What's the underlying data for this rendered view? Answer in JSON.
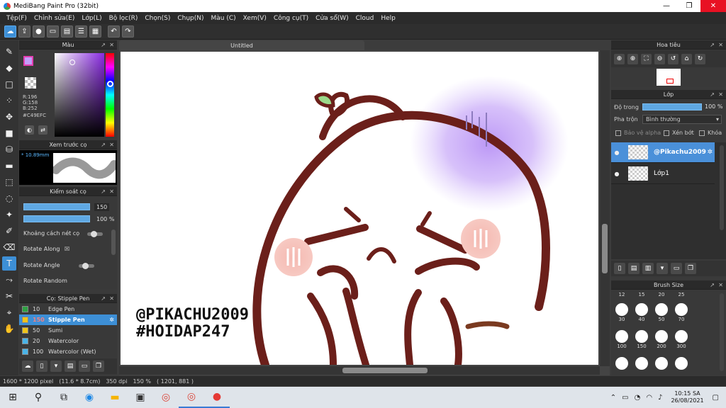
{
  "window": {
    "title": "MediBang Paint Pro (32bit)",
    "min": "—",
    "max": "❐",
    "close": "✕"
  },
  "menu": [
    "Tệp(F)",
    "Chỉnh sửa(E)",
    "Lớp(L)",
    "Bộ lọc(R)",
    "Chọn(S)",
    "Chụp(N)",
    "Màu (C)",
    "Xem(V)",
    "Công cụ(T)",
    "Cửa sổ(W)",
    "Cloud",
    "Help"
  ],
  "toolbar_icons": [
    "cloud-icon",
    "share-icon",
    "chat-icon",
    "comment-icon",
    "page-icon",
    "list-icon",
    "grid-icon",
    "undo-icon",
    "redo-icon"
  ],
  "color_panel": {
    "title": "Màu",
    "r": "R:196",
    "g": "G:158",
    "b": "B:252",
    "hex": "#C49EFC",
    "fg_color": "#C49EFC"
  },
  "brush_preview": {
    "title": "Xem trước cọ",
    "size": "* 10.89mm"
  },
  "brush_control": {
    "title": "Kiểm soát cọ",
    "size_value": "150",
    "opacity_value": "100 %",
    "options": [
      "Khoảng cách nét cọ",
      "Rotate Along",
      "Rotate Angle",
      "Rotate Random"
    ]
  },
  "brush_list": {
    "title": "Cọ: Stipple Pen",
    "items": [
      {
        "num": "10",
        "name": "Edge Pen",
        "color": "#2ea043",
        "selected": false
      },
      {
        "num": "150",
        "name": "Stipple Pen",
        "color": "#f0c419",
        "selected": true
      },
      {
        "num": "50",
        "name": "Sumi",
        "color": "#f0c419",
        "selected": false
      },
      {
        "num": "20",
        "name": "Watercolor",
        "color": "#4ab4e8",
        "selected": false
      },
      {
        "num": "100",
        "name": "Watercolor (Wet)",
        "color": "#4ab4e8",
        "selected": false
      }
    ]
  },
  "document": {
    "tab_title": "Untitled",
    "watermark_line1": "@PIKACHU2009",
    "watermark_line2": "#HOIDAP247"
  },
  "navigator": {
    "title": "Hoa tiêu"
  },
  "layers": {
    "title": "Lớp",
    "opacity_label": "Độ trong",
    "opacity_value": "100 %",
    "blend_label": "Pha trộn",
    "blend_value": "Bình thường",
    "protect_alpha": "Bảo vệ alpha",
    "clipping": "Xén bớt",
    "lock": "Khóa",
    "items": [
      {
        "name": "@Pikachu2009",
        "selected": true
      },
      {
        "name": "Lớp1",
        "selected": false
      }
    ]
  },
  "brush_size": {
    "title": "Brush Size",
    "sizes": [
      "12",
      "15",
      "20",
      "25",
      "30",
      "40",
      "50",
      "70",
      "100",
      "150",
      "200",
      "300"
    ]
  },
  "status": {
    "dimensions": "1600 * 1200 pixel",
    "physical": "(11.6 * 8.7cm)",
    "dpi": "350 dpi",
    "zoom": "150 %",
    "cursor": "( 1201, 881 )"
  },
  "taskbar": {
    "time": "10:15 SA",
    "date": "26/08/2021"
  }
}
